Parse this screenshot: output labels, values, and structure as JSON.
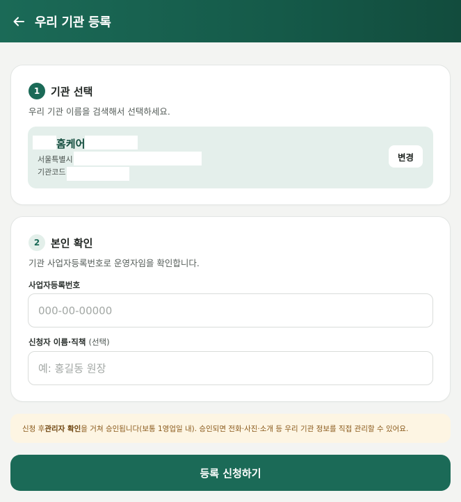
{
  "header": {
    "back_icon": "arrow-left-icon",
    "title": "우리 기관 등록"
  },
  "step1": {
    "number": "1",
    "title": "기관 선택",
    "description": "우리 기관 이름을 검색해서 선택하세요.",
    "selected": {
      "name": "홈케어",
      "address_label": "서울특별시",
      "code_label": "기관코드",
      "change_label": "변경"
    }
  },
  "step2": {
    "number": "2",
    "title": "본인 확인",
    "description": "기관 사업자등록번호로 운영자임을 확인합니다.",
    "biz_number": {
      "label": "사업자등록번호",
      "placeholder": "000-00-00000",
      "value": ""
    },
    "applicant": {
      "label": "신청자 이름·직책",
      "optional": "(선택)",
      "placeholder": "예: 홍길동 원장",
      "value": ""
    }
  },
  "notice": {
    "prefix": "신청 후 ",
    "emphasis": "관리자 확인",
    "suffix": "을 거쳐 승인됩니다(보통 1영업일 내). 승인되면 전화·사진·소개 등 우리 기관 정보를 직접 관리할 수 있어요."
  },
  "submit_label": "등록 신청하기",
  "colors": {
    "brand": "#1b6a57",
    "brand_light": "#e4efeb",
    "notice_bg": "#fdf5e3",
    "notice_text": "#8a5a1c"
  }
}
